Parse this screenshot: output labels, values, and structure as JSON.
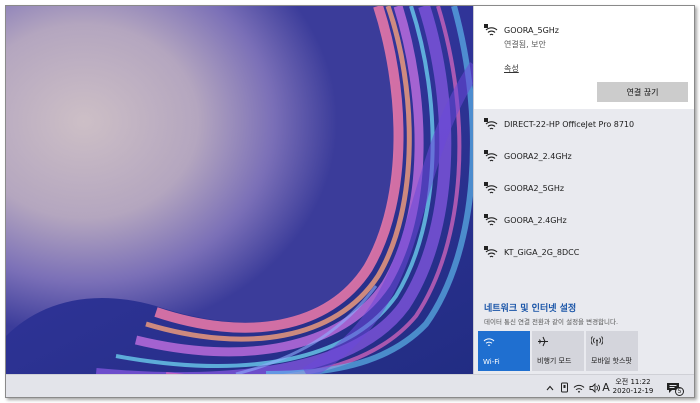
{
  "active_network": {
    "ssid": "GOORA_5GHz",
    "status": "연결됨, 보안",
    "properties_label": "속성",
    "disconnect_label": "연결 끊기"
  },
  "networks": [
    {
      "ssid": "DIRECT-22-HP OfficeJet Pro 8710",
      "icon": "wifi-secured-icon"
    },
    {
      "ssid": "GOORA2_2.4GHz",
      "icon": "wifi-secured-icon"
    },
    {
      "ssid": "GOORA2_5GHz",
      "icon": "wifi-secured-icon"
    },
    {
      "ssid": "GOORA_2.4GHz",
      "icon": "wifi-secured-icon"
    },
    {
      "ssid": "KT_GiGA_2G_8DCC",
      "icon": "wifi-secured-icon"
    }
  ],
  "network_settings": {
    "title": "네트워크 및 인터넷 설정",
    "description": "데이터 통신 연결 전환과 같이 설정을 변경합니다."
  },
  "quick_actions": [
    {
      "label": "Wi-Fi",
      "icon": "wifi-icon",
      "on": true
    },
    {
      "label": "비행기 모드",
      "icon": "airplane-icon",
      "on": false
    },
    {
      "label": "모바일 핫스팟",
      "icon": "hotspot-icon",
      "on": false
    }
  ],
  "taskbar": {
    "ime_label": "A",
    "clock_time": "오전 11:22",
    "clock_date": "2020-12-19",
    "notification_count": "5"
  },
  "colors": {
    "accent": "#1f6fd0",
    "link": "#1a55a8",
    "flyout_bg": "#e9eaef"
  }
}
